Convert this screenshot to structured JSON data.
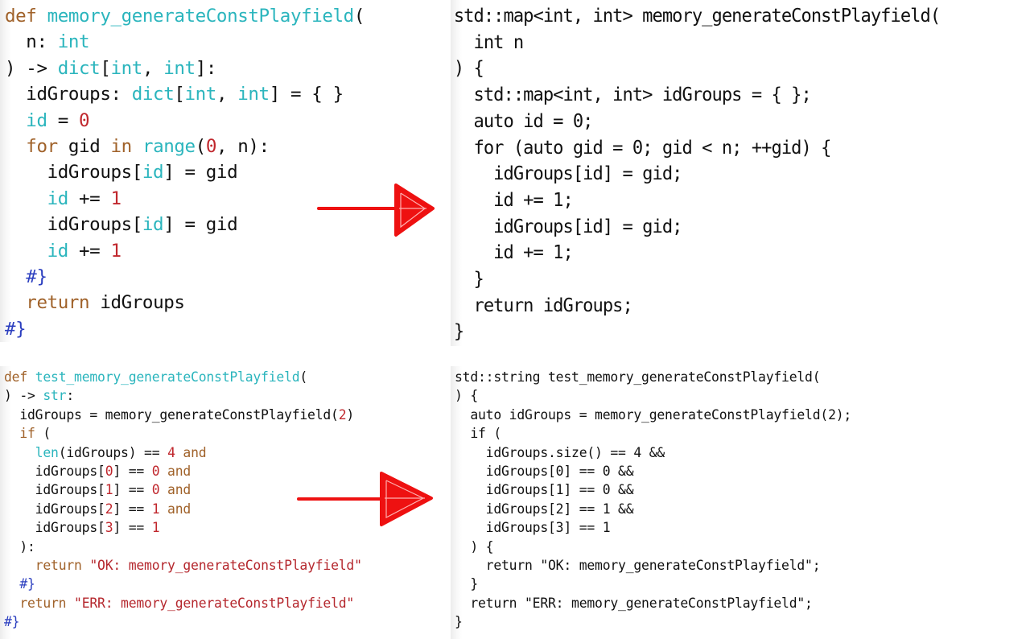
{
  "colors": {
    "keyword": "#a0622a",
    "type": "#2bb5bd",
    "number": "#c0272d",
    "string": "#b5282e",
    "comment": "#2c3fbf",
    "plain": "#111111",
    "arrow": "#ee1111"
  },
  "panels": [
    {
      "id": "python-function",
      "language": "python",
      "lines": [
        [
          [
            "kw",
            "def "
          ],
          [
            "ty",
            "memory_generateConstPlayfield"
          ],
          [
            "pl",
            "("
          ]
        ],
        [
          [
            "pl",
            "  n: "
          ],
          [
            "ty",
            "int"
          ]
        ],
        [
          [
            "pl",
            ") -> "
          ],
          [
            "ty",
            "dict"
          ],
          [
            "pl",
            "["
          ],
          [
            "ty",
            "int"
          ],
          [
            "pl",
            ", "
          ],
          [
            "ty",
            "int"
          ],
          [
            "pl",
            "]:"
          ]
        ],
        [
          [
            "pl",
            "  idGroups: "
          ],
          [
            "ty",
            "dict"
          ],
          [
            "pl",
            "["
          ],
          [
            "ty",
            "int"
          ],
          [
            "pl",
            ", "
          ],
          [
            "ty",
            "int"
          ],
          [
            "pl",
            "] = { }"
          ]
        ],
        [
          [
            "pl",
            "  "
          ],
          [
            "ty",
            "id"
          ],
          [
            "pl",
            " = "
          ],
          [
            "num",
            "0"
          ]
        ],
        [
          [
            "pl",
            "  "
          ],
          [
            "kw",
            "for"
          ],
          [
            "pl",
            " gid "
          ],
          [
            "kw",
            "in"
          ],
          [
            "pl",
            " "
          ],
          [
            "ty",
            "range"
          ],
          [
            "pl",
            "("
          ],
          [
            "num",
            "0"
          ],
          [
            "pl",
            ", n):"
          ]
        ],
        [
          [
            "pl",
            "    idGroups["
          ],
          [
            "ty",
            "id"
          ],
          [
            "pl",
            "] = gid"
          ]
        ],
        [
          [
            "pl",
            "    "
          ],
          [
            "ty",
            "id"
          ],
          [
            "pl",
            " += "
          ],
          [
            "num",
            "1"
          ]
        ],
        [
          [
            "pl",
            "    idGroups["
          ],
          [
            "ty",
            "id"
          ],
          [
            "pl",
            "] = gid"
          ]
        ],
        [
          [
            "pl",
            "    "
          ],
          [
            "ty",
            "id"
          ],
          [
            "pl",
            " += "
          ],
          [
            "num",
            "1"
          ]
        ],
        [
          [
            "pl",
            "  "
          ],
          [
            "cm",
            "#}"
          ]
        ],
        [
          [
            "pl",
            "  "
          ],
          [
            "kw",
            "return"
          ],
          [
            "pl",
            " idGroups"
          ]
        ],
        [
          [
            "cm",
            "#}"
          ]
        ]
      ]
    },
    {
      "id": "cpp-function",
      "language": "cpp",
      "lines": [
        [
          [
            "pl",
            "std::map<int, int> memory_generateConstPlayfield("
          ]
        ],
        [
          [
            "pl",
            "  int n"
          ]
        ],
        [
          [
            "pl",
            ") {"
          ]
        ],
        [
          [
            "pl",
            "  std::map<int, int> idGroups = { };"
          ]
        ],
        [
          [
            "pl",
            "  auto id = 0;"
          ]
        ],
        [
          [
            "pl",
            "  for (auto gid = 0; gid < n; ++gid) {"
          ]
        ],
        [
          [
            "pl",
            "    idGroups[id] = gid;"
          ]
        ],
        [
          [
            "pl",
            "    id += 1;"
          ]
        ],
        [
          [
            "pl",
            "    idGroups[id] = gid;"
          ]
        ],
        [
          [
            "pl",
            "    id += 1;"
          ]
        ],
        [
          [
            "pl",
            "  }"
          ]
        ],
        [
          [
            "pl",
            "  return idGroups;"
          ]
        ],
        [
          [
            "pl",
            "}"
          ]
        ]
      ]
    },
    {
      "id": "python-test",
      "language": "python",
      "lines": [
        [
          [
            "kw",
            "def "
          ],
          [
            "ty",
            "test_memory_generateConstPlayfield"
          ],
          [
            "pl",
            "("
          ]
        ],
        [
          [
            "pl",
            ") -> "
          ],
          [
            "ty",
            "str"
          ],
          [
            "pl",
            ":"
          ]
        ],
        [
          [
            "pl",
            "  idGroups = memory_generateConstPlayfield("
          ],
          [
            "num",
            "2"
          ],
          [
            "pl",
            ")"
          ]
        ],
        [
          [
            "pl",
            "  "
          ],
          [
            "kw",
            "if"
          ],
          [
            "pl",
            " ("
          ]
        ],
        [
          [
            "pl",
            "    "
          ],
          [
            "ty",
            "len"
          ],
          [
            "pl",
            "(idGroups) == "
          ],
          [
            "num",
            "4"
          ],
          [
            "kw",
            " and"
          ]
        ],
        [
          [
            "pl",
            "    idGroups["
          ],
          [
            "num",
            "0"
          ],
          [
            "pl",
            "] == "
          ],
          [
            "num",
            "0"
          ],
          [
            "kw",
            " and"
          ]
        ],
        [
          [
            "pl",
            "    idGroups["
          ],
          [
            "num",
            "1"
          ],
          [
            "pl",
            "] == "
          ],
          [
            "num",
            "0"
          ],
          [
            "kw",
            " and"
          ]
        ],
        [
          [
            "pl",
            "    idGroups["
          ],
          [
            "num",
            "2"
          ],
          [
            "pl",
            "] == "
          ],
          [
            "num",
            "1"
          ],
          [
            "kw",
            " and"
          ]
        ],
        [
          [
            "pl",
            "    idGroups["
          ],
          [
            "num",
            "3"
          ],
          [
            "pl",
            "] == "
          ],
          [
            "num",
            "1"
          ]
        ],
        [
          [
            "pl",
            "  ):"
          ]
        ],
        [
          [
            "pl",
            "    "
          ],
          [
            "kw",
            "return"
          ],
          [
            "pl",
            " "
          ],
          [
            "str",
            "\"OK: memory_generateConstPlayfield\""
          ]
        ],
        [
          [
            "pl",
            "  "
          ],
          [
            "cm",
            "#}"
          ]
        ],
        [
          [
            "pl",
            "  "
          ],
          [
            "kw",
            "return"
          ],
          [
            "pl",
            " "
          ],
          [
            "str",
            "\"ERR: memory_generateConstPlayfield\""
          ]
        ],
        [
          [
            "cm",
            "#}"
          ]
        ]
      ]
    },
    {
      "id": "cpp-test",
      "language": "cpp",
      "lines": [
        [
          [
            "pl",
            "std::string test_memory_generateConstPlayfield("
          ]
        ],
        [
          [
            "pl",
            ") {"
          ]
        ],
        [
          [
            "pl",
            "  auto idGroups = memory_generateConstPlayfield(2);"
          ]
        ],
        [
          [
            "pl",
            "  if ("
          ]
        ],
        [
          [
            "pl",
            "    idGroups.size() == 4 &&"
          ]
        ],
        [
          [
            "pl",
            "    idGroups[0] == 0 &&"
          ]
        ],
        [
          [
            "pl",
            "    idGroups[1] == 0 &&"
          ]
        ],
        [
          [
            "pl",
            "    idGroups[2] == 1 &&"
          ]
        ],
        [
          [
            "pl",
            "    idGroups[3] == 1"
          ]
        ],
        [
          [
            "pl",
            "  ) {"
          ]
        ],
        [
          [
            "pl",
            "    return \"OK: memory_generateConstPlayfield\";"
          ]
        ],
        [
          [
            "pl",
            "  }"
          ]
        ],
        [
          [
            "pl",
            "  return \"ERR: memory_generateConstPlayfield\";"
          ]
        ],
        [
          [
            "pl",
            "}"
          ]
        ]
      ]
    }
  ],
  "arrows": [
    {
      "id": "arrow-top",
      "from": "python-function",
      "to": "cpp-function",
      "direction": "right"
    },
    {
      "id": "arrow-bottom",
      "from": "python-test",
      "to": "cpp-test",
      "direction": "right"
    }
  ]
}
